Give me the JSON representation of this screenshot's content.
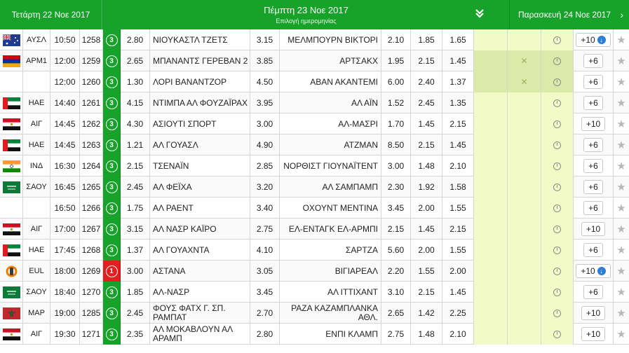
{
  "header": {
    "prev_day": "Τετάρτη 22 Νοε 2017",
    "current_day": "Πέμπτη 23 Νοε 2017",
    "date_picker_label": "Επιλογή ημερομηνίας",
    "next_day": "Παρασκευή 24 Νοε 2017",
    "next_arrow": "›"
  },
  "colors": {
    "green": "#17a32a",
    "red": "#e02020",
    "highlight": "#f2fac7"
  },
  "rows": [
    {
      "flag": "australia",
      "country": "ΑΥΣΛ",
      "time": "10:50",
      "code": "1258",
      "events": "3",
      "odd1": "2.80",
      "home": "ΝΙΟΥΚΑΣΤΛ ΤΖΕΤΣ",
      "oddx": "3.15",
      "away": "ΜΕΛΜΠΟΥΡΝ ΒΙΚΤΟΡΙ",
      "odd2": "2.10",
      "under": "1.85",
      "over": "1.65",
      "more": "+10",
      "more_down": true
    },
    {
      "flag": "armenia",
      "country": "ΑΡΜ1",
      "time": "12:00",
      "code": "1259",
      "events": "3",
      "odd1": "2.65",
      "home": "ΜΠΑΝΑΝΤΣ ΓΕΡΕΒΑΝ 2",
      "oddx": "3.85",
      "away": "ΑΡΤΣΑΚΧ",
      "odd2": "1.95",
      "under": "2.15",
      "over": "1.45",
      "more": "+6",
      "nobet": true
    },
    {
      "flag": "",
      "country": "",
      "time": "12:00",
      "code": "1260",
      "events": "3",
      "odd1": "1.30",
      "home": "ΛΟΡΙ ΒΑΝΑΝΤΖΟΡ",
      "oddx": "4.50",
      "away": "ΑΒΑΝ ΑΚΑΝΤΕΜΙ",
      "odd2": "6.00",
      "under": "2.40",
      "over": "1.37",
      "more": "+6",
      "nobet": true
    },
    {
      "flag": "uae",
      "country": "ΗΑΕ",
      "time": "14:40",
      "code": "1261",
      "events": "3",
      "odd1": "4.15",
      "home": "ΝΤΙΜΠΑ ΑΛ ΦΟΥΖΑΪΡΑΧ",
      "oddx": "3.95",
      "away": "ΑΛ ΑΪΝ",
      "odd2": "1.52",
      "under": "2.45",
      "over": "1.35",
      "more": "+6"
    },
    {
      "flag": "egypt",
      "country": "ΑΙΓ",
      "time": "14:45",
      "code": "1262",
      "events": "3",
      "odd1": "4.30",
      "home": "ΑΣΙΟΥΤΙ ΣΠΟΡΤ",
      "oddx": "3.00",
      "away": "ΑΛ-ΜΑΣΡΙ",
      "odd2": "1.70",
      "under": "1.45",
      "over": "2.15",
      "more": "+10"
    },
    {
      "flag": "uae",
      "country": "ΗΑΕ",
      "time": "14:45",
      "code": "1263",
      "events": "3",
      "odd1": "1.21",
      "home": "ΑΛ ΓΟΥΑΣΛ",
      "oddx": "4.90",
      "away": "ΑΤΖΜΑΝ",
      "odd2": "8.50",
      "under": "2.15",
      "over": "1.45",
      "more": "+6"
    },
    {
      "flag": "india",
      "country": "ΙΝΔ",
      "time": "16:30",
      "code": "1264",
      "events": "3",
      "odd1": "2.15",
      "home": "ΤΣΕΝΑΪΝ",
      "oddx": "2.85",
      "away": "ΝΟΡΘΙΣΤ ΓΙΟΥΝΑΪΤΕΝΤ",
      "odd2": "3.00",
      "under": "1.48",
      "over": "2.10",
      "more": "+6"
    },
    {
      "flag": "saudi",
      "country": "ΣΑΟΥ",
      "time": "16:45",
      "code": "1265",
      "events": "3",
      "odd1": "2.45",
      "home": "ΑΛ ΦΕΪΧΑ",
      "oddx": "3.20",
      "away": "ΑΛ ΣΑΜΠΑΜΠ",
      "odd2": "2.30",
      "under": "1.92",
      "over": "1.58",
      "more": "+6"
    },
    {
      "flag": "",
      "country": "",
      "time": "16:50",
      "code": "1266",
      "events": "3",
      "odd1": "1.75",
      "home": "ΑΛ ΡΑΕΝΤ",
      "oddx": "3.40",
      "away": "ΟΧΟΥΝΤ ΜΕΝΤΙΝΑ",
      "odd2": "3.45",
      "under": "2.00",
      "over": "1.55",
      "more": "+6"
    },
    {
      "flag": "egypt",
      "country": "ΑΙΓ",
      "time": "17:00",
      "code": "1267",
      "events": "3",
      "odd1": "3.15",
      "home": "ΑΛ ΝΑΣΡ ΚΑΪΡΟ",
      "oddx": "2.75",
      "away": "ΕΛ-ΕΝΤΑΓΚ ΕΛ-ΑΡΜΠΙ",
      "odd2": "2.15",
      "under": "1.45",
      "over": "2.15",
      "more": "+10"
    },
    {
      "flag": "uae",
      "country": "ΗΑΕ",
      "time": "17:45",
      "code": "1268",
      "events": "3",
      "odd1": "1.37",
      "home": "ΑΛ ΓΟΥΑΧΝΤΑ",
      "oddx": "4.10",
      "away": "ΣΑΡΤΖΑ",
      "odd2": "5.60",
      "under": "2.00",
      "over": "1.55",
      "more": "+6"
    },
    {
      "flag": "europa",
      "country": "EUL",
      "time": "18:00",
      "code": "1269",
      "events": "1",
      "events_red": true,
      "odd1": "3.00",
      "home": "ΑΣΤΑΝΑ",
      "oddx": "3.05",
      "away": "ΒΙΓΙΑΡΕΑΛ",
      "odd2": "2.20",
      "under": "1.55",
      "over": "2.00",
      "more": "+10",
      "more_down": true
    },
    {
      "flag": "saudi",
      "country": "ΣΑΟΥ",
      "time": "18:40",
      "code": "1270",
      "events": "3",
      "odd1": "1.85",
      "home": "ΑΛ-ΝΑΣΡ",
      "oddx": "3.45",
      "away": "ΑΛ ΙΤΤΙΧΑΝΤ",
      "odd2": "3.10",
      "under": "2.15",
      "over": "1.45",
      "more": "+6"
    },
    {
      "flag": "morocco",
      "country": "ΜΑΡ",
      "time": "19:00",
      "code": "1285",
      "events": "3",
      "odd1": "2.45",
      "home": "ΦΟΥΣ ΦΑΤΧ Γ. ΣΠ. ΡΑΜΠΑΤ",
      "oddx": "2.70",
      "away": "ΡΑΖΑ ΚΑΖΑΜΠΛΑΝΚΑ ΑΘΛ.",
      "odd2": "2.65",
      "under": "1.42",
      "over": "2.25",
      "more": "+10"
    },
    {
      "flag": "egypt",
      "country": "ΑΙΓ",
      "time": "19:30",
      "code": "1271",
      "events": "3",
      "odd1": "2.35",
      "home": "ΑΛ ΜΟΚΑΒΛΟΥΝ ΑΛ ΑΡΑΜΠ",
      "oddx": "2.80",
      "away": "ΕΝΠΙ ΚΛΑΜΠ",
      "odd2": "2.75",
      "under": "1.48",
      "over": "2.10",
      "more": "+10"
    }
  ]
}
